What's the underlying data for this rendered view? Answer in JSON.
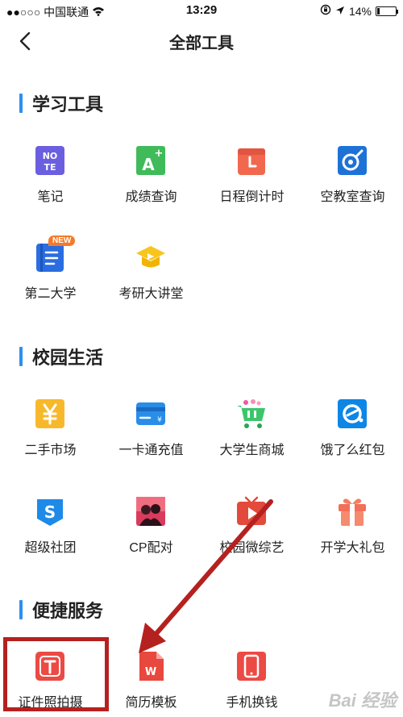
{
  "status_bar": {
    "carrier": "●●○○○ 中国联通",
    "time": "13:29",
    "battery": "14%",
    "battery_level": 0.14
  },
  "nav": {
    "title": "全部工具"
  },
  "sections": [
    {
      "title": "学习工具",
      "tools": [
        {
          "label": "笔记",
          "icon": "note-icon"
        },
        {
          "label": "成绩查询",
          "icon": "grade-query-icon"
        },
        {
          "label": "日程倒计时",
          "icon": "countdown-icon"
        },
        {
          "label": "空教室查询",
          "icon": "empty-classroom-icon"
        },
        {
          "label": "第二大学",
          "icon": "second-university-icon",
          "badge": "NEW"
        },
        {
          "label": "考研大讲堂",
          "icon": "graduation-cap-icon"
        }
      ]
    },
    {
      "title": "校园生活",
      "tools": [
        {
          "label": "二手市场",
          "icon": "yen-icon"
        },
        {
          "label": "一卡通充值",
          "icon": "card-icon"
        },
        {
          "label": "大学生商城",
          "icon": "shopping-cart-icon"
        },
        {
          "label": "饿了么红包",
          "icon": "eleme-icon"
        },
        {
          "label": "超级社团",
          "icon": "club-icon"
        },
        {
          "label": "CP配对",
          "icon": "couple-icon"
        },
        {
          "label": "校园微综艺",
          "icon": "tv-play-icon"
        },
        {
          "label": "开学大礼包",
          "icon": "gift-icon"
        }
      ]
    },
    {
      "title": "便捷服务",
      "tools": [
        {
          "label": "证件照拍摄",
          "icon": "id-photo-icon"
        },
        {
          "label": "简历模板",
          "icon": "resume-icon"
        },
        {
          "label": "手机换钱",
          "icon": "phone-icon"
        }
      ]
    }
  ],
  "watermark": "Bai 经验",
  "colors": {
    "accent": "#2e8ff0",
    "annotation": "#b5211f"
  }
}
